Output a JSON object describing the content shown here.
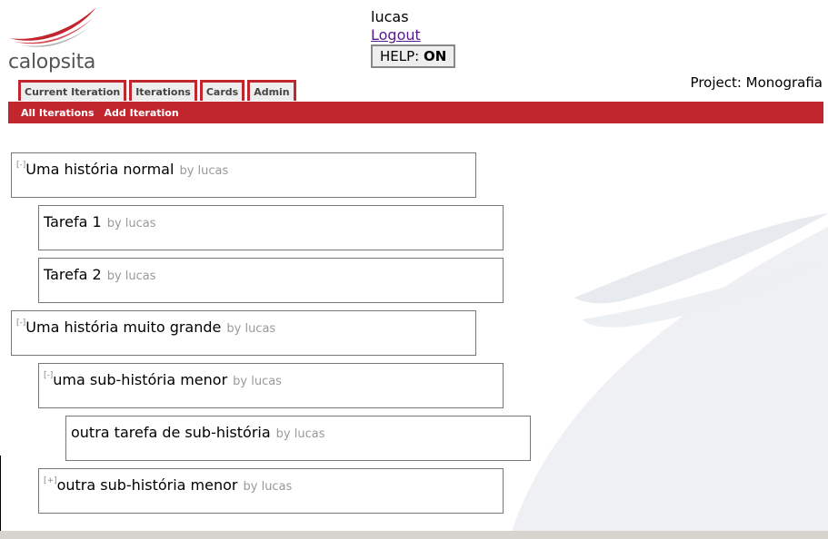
{
  "logo": {
    "text": "calopsita"
  },
  "user": {
    "name": "lucas",
    "logout_label": "Logout"
  },
  "help": {
    "label": "HELP:",
    "state": "ON"
  },
  "project": {
    "label": "Project: Monografia"
  },
  "tabs": [
    {
      "label": "Current Iteration"
    },
    {
      "label": "Iterations"
    },
    {
      "label": "Cards"
    },
    {
      "label": "Admin"
    }
  ],
  "subnav": [
    {
      "label": "All Iterations"
    },
    {
      "label": "Add Iteration"
    }
  ],
  "cards": [
    {
      "title": "Uma história normal",
      "author": "by lucas",
      "toggle": "[-]"
    },
    {
      "title": "Tarefa 1",
      "author": "by lucas",
      "toggle": ""
    },
    {
      "title": "Tarefa 2",
      "author": "by lucas",
      "toggle": ""
    },
    {
      "title": "Uma história muito grande",
      "author": "by lucas",
      "toggle": "[-]"
    },
    {
      "title": "uma sub-história menor",
      "author": "by lucas",
      "toggle": "[-]"
    },
    {
      "title": "outra tarefa de sub-história",
      "author": "by lucas",
      "toggle": ""
    },
    {
      "title": "outra sub-história menor",
      "author": "by lucas",
      "toggle": "[+]"
    }
  ],
  "colors": {
    "brand": "#c1252d",
    "link_visited": "#551a8b"
  }
}
